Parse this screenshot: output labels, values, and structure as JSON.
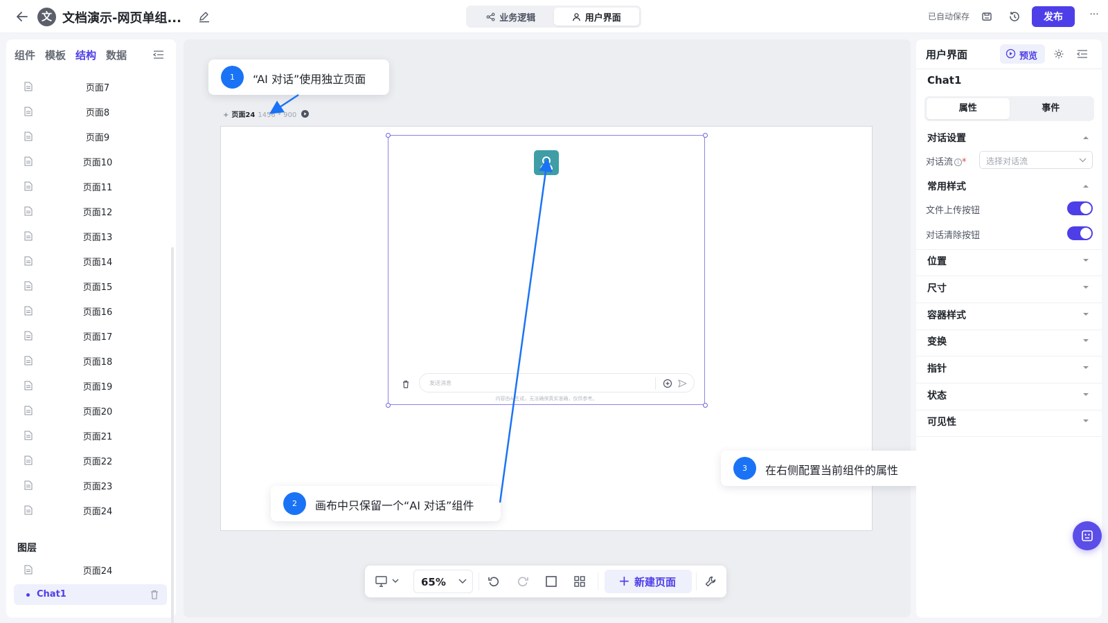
{
  "header": {
    "app_icon_char": "文",
    "title": "文档演示-网页单组...",
    "mode_tabs": [
      {
        "label": "业务逻辑",
        "icon": "share-icon",
        "active": false
      },
      {
        "label": "用户界面",
        "icon": "user-icon",
        "active": true
      }
    ],
    "autosave": "已自动保存",
    "publish": "发布",
    "more": "···"
  },
  "left_panel": {
    "tabs": [
      "组件",
      "模板",
      "结构",
      "数据"
    ],
    "active_tab": "结构",
    "pages": [
      "页面7",
      "页面8",
      "页面9",
      "页面10",
      "页面11",
      "页面12",
      "页面13",
      "页面14",
      "页面15",
      "页面16",
      "页面17",
      "页面18",
      "页面19",
      "页面20",
      "页面21",
      "页面22",
      "页面23",
      "页面24"
    ],
    "layers_title": "图层",
    "layer_page": "页面24",
    "layer_component": "Chat1"
  },
  "canvas": {
    "page_label": "页面24",
    "page_dims": "1456 * 900",
    "chat": {
      "input_placeholder": "发送消息",
      "disclaimer": "内容由AI生成，无法确保真实准确，仅供参考。"
    }
  },
  "callouts": [
    {
      "num": "1",
      "text": "“AI 对话”使用独立页面"
    },
    {
      "num": "2",
      "text": "画布中只保留一个“AI 对话”组件"
    },
    {
      "num": "3",
      "text": "在右侧配置当前组件的属性"
    }
  ],
  "toolbar": {
    "zoom": "65%",
    "new_page": "新建页面"
  },
  "right_panel": {
    "title": "用户界面",
    "preview": "预览",
    "component_name": "Chat1",
    "tabs": [
      "属性",
      "事件"
    ],
    "active_tab": "属性",
    "dialog_settings": "对话设置",
    "flow_label": "对话流",
    "flow_required": "*",
    "flow_placeholder": "选择对话流",
    "common_style": "常用样式",
    "file_upload_label": "文件上传按钮",
    "file_upload_on": true,
    "clear_label": "对话清除按钮",
    "clear_on": true,
    "sections": [
      "位置",
      "尺寸",
      "容器样式",
      "变换",
      "指针",
      "状态",
      "可见性"
    ]
  },
  "colors": {
    "accent": "#4e3ee8",
    "callout_blue": "#1a73f5",
    "avatar_teal": "#3f9da5"
  }
}
